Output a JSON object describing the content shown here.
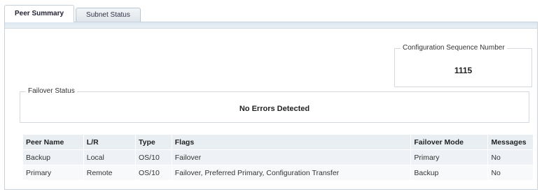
{
  "tabs": [
    {
      "label": "Peer Summary",
      "active": true
    },
    {
      "label": "Subnet Status",
      "active": false
    }
  ],
  "config_sequence": {
    "legend": "Configuration Sequence Number",
    "value": "1115"
  },
  "failover_status": {
    "legend": "Failover Status",
    "message": "No Errors Detected"
  },
  "peer_table": {
    "columns": [
      "Peer Name",
      "L/R",
      "Type",
      "Flags",
      "Failover Mode",
      "Messages"
    ],
    "rows": [
      [
        "Backup",
        "Local",
        "OS/10",
        "Failover",
        "Primary",
        "No"
      ],
      [
        "Primary",
        "Remote",
        "OS/10",
        "Failover, Preferred Primary, Configuration Transfer",
        "Backup",
        "No"
      ]
    ]
  },
  "colors": {
    "tab_border": "#b9c6d2",
    "header_bg": "#e9eef3",
    "row_bg": "#eef2f6",
    "panel_band": "#dce6ef"
  }
}
